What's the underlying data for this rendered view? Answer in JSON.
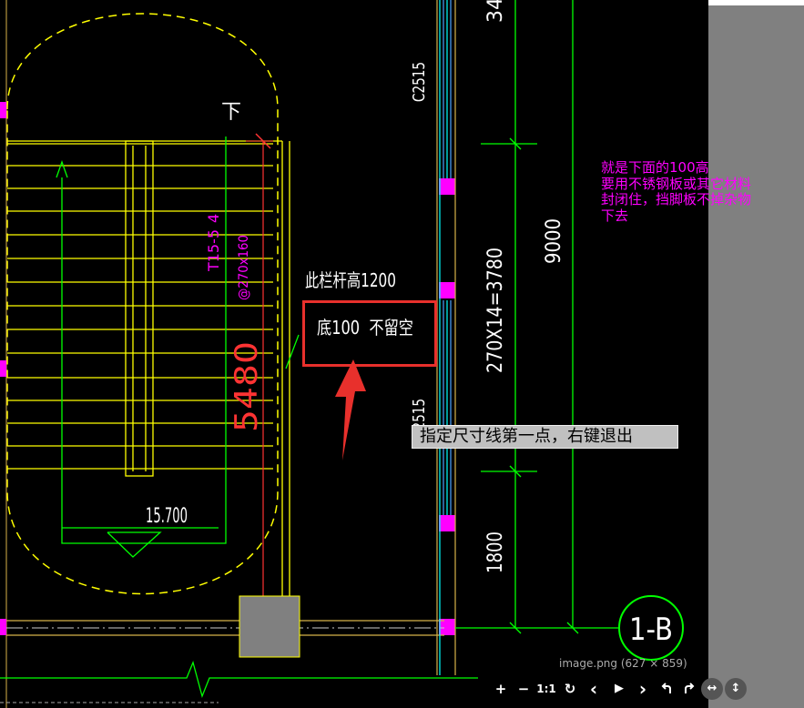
{
  "cad": {
    "labels": {
      "down": "下",
      "railing_height": "此栏杆高1200",
      "bottom_note": "底100  不留空",
      "elevation": "15.700",
      "width_5480": "5480",
      "dim_3780": "270X14=3780",
      "dim_9000": "9000",
      "dim_1800": "1800",
      "dim_top": "34",
      "c2515_a": "C2515",
      "c2515_b": "C2515",
      "stair_a": "T15-5",
      "stair_b": "@270x160",
      "stair_c": "4",
      "axis_bubble": "1-B"
    },
    "colors": {
      "yellow": "#ffff00",
      "green": "#00ff00",
      "magenta": "#ff00ff",
      "cyan": "#00ffff",
      "red": "#ff3333",
      "annotation_red": "#e8302c",
      "wall": "#d7b24a"
    }
  },
  "note": {
    "text": "就是下面的100高\n要用不锈钢板或其它材料\n封闭住，挡脚板不掉杂物\n下去"
  },
  "tooltip": {
    "text": "指定尺寸线第一点，右键退出"
  },
  "image_caption": "image.png (627 × 859)",
  "toolbar": {
    "zoom_in": "+",
    "zoom_out": "−",
    "actual_size": "1:1",
    "rotate": "↻",
    "prev": "‹",
    "play": "▶",
    "next": "›",
    "rotate_left_icon": "undo-icon",
    "rotate_right_icon": "redo-icon",
    "fit_width": "↔",
    "fit_height": "↕"
  }
}
